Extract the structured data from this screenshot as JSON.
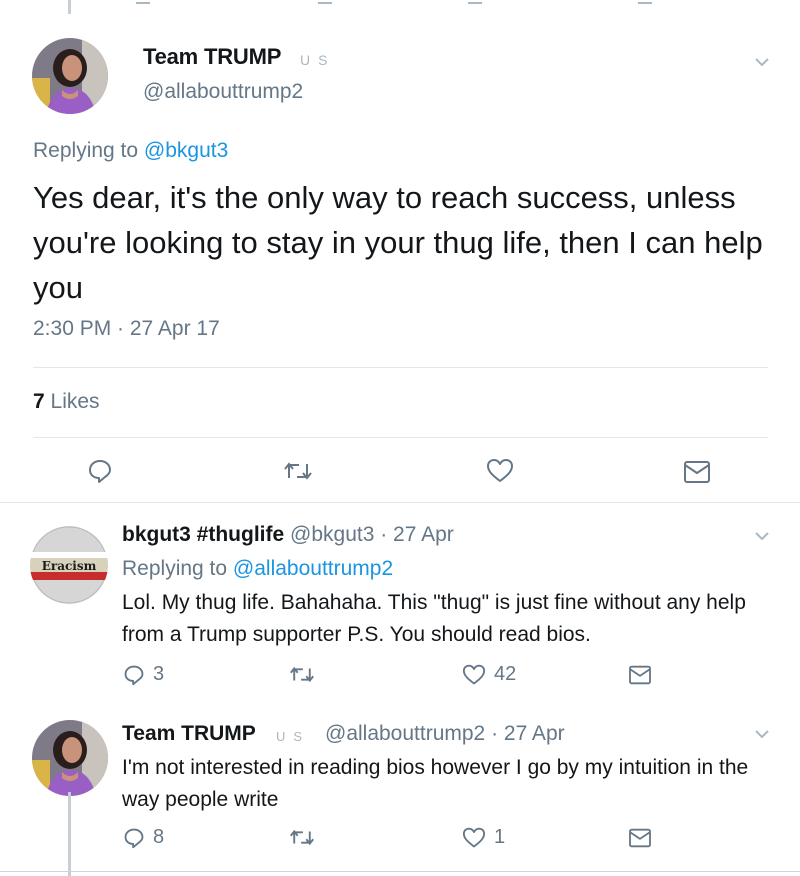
{
  "main_tweet": {
    "display_name": "Team TRUMP",
    "badges": [
      "U",
      "S"
    ],
    "handle": "@allabouttrump2",
    "replying_prefix": "Replying to",
    "replying_handle": "@bkgut3",
    "text": "Yes dear, it's the only way to reach success, unless you're looking to stay in your thug life, then I can help you",
    "timestamp": "2:30 PM · 27 Apr 17",
    "likes_count": "7",
    "likes_label": "Likes",
    "actions": [
      {
        "icon": "reply-icon"
      },
      {
        "icon": "retweet-icon"
      },
      {
        "icon": "heart-icon"
      },
      {
        "icon": "message-icon"
      }
    ]
  },
  "replies": [
    {
      "display_name": "bkgut3 #thuglife",
      "handle_time": "@bkgut3 · 27 Apr",
      "avatar_text": "Eracism",
      "replying_prefix": "Replying to",
      "replying_handle": "@allabouttrump2",
      "text": "Lol. My thug life. Bahahaha. This \"thug\" is just fine without any help from a Trump supporter P.S. You should read bios.",
      "reply_count": "3",
      "retweet_count": "",
      "like_count": "42"
    },
    {
      "display_name": "Team TRUMP",
      "badges": [
        "U",
        "S"
      ],
      "handle_time": "@allabouttrump2 · 27 Apr",
      "text": "I'm not interested in reading bios however I go by my intuition in the way people write",
      "reply_count": "8",
      "retweet_count": "",
      "like_count": "1"
    }
  ],
  "colors": {
    "text": "#14171a",
    "secondary": "#657786",
    "link": "#1b95e0",
    "divider": "#e1e8ed",
    "thread_line": "#c8cfd4"
  }
}
